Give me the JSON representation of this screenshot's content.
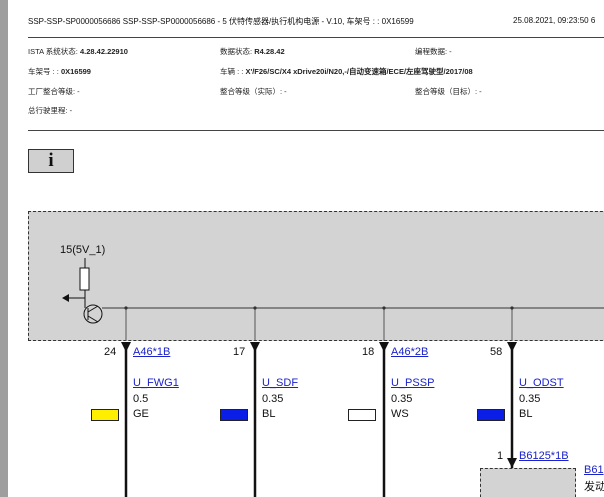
{
  "header": {
    "title": "SSP-SSP-SP0000056686 SSP-SSP-SP0000056686 - 5 伏特传感器/执行机构电源 - V.10, 车架号 : : 0X16599",
    "datetime": "25.08.2021, 09:23:50 6"
  },
  "meta": {
    "ista_label": "ISTA 系统状态:",
    "ista_value": "4.28.42.22910",
    "data_label": "数据状态:",
    "data_value": "R4.28.42",
    "prog_label": "编程数据: -",
    "vin_label": "车架号 : :",
    "vin_value": "0X16599",
    "vehicle_label": "车辆 : :",
    "vehicle_value": "X'/F26/SC/X4 xDrive20i/N20,-/自动变速箱/ECE/左座驾驶型/2017/08",
    "factory_level": "工厂整合等级: -",
    "actual_level": "整合等级（实际）: -",
    "target_level": "整合等级（目标）: -",
    "mileage": "总行驶里程: -"
  },
  "info_button": {
    "label": "i"
  },
  "diagram": {
    "supply_label": "15(5V_1)",
    "wires": [
      {
        "pin": "24",
        "connector": "A46*1B",
        "signal": "U_FWG1",
        "size": "0.5",
        "color_code": "GE",
        "color": "#ffee00"
      },
      {
        "pin": "17",
        "connector": "",
        "signal": "U_SDF",
        "size": "0.35",
        "color_code": "BL",
        "color": "#0a1ee8"
      },
      {
        "pin": "18",
        "connector": "A46*2B",
        "signal": "U_PSSP",
        "size": "0.35",
        "color_code": "WS",
        "color": "#ffffff"
      },
      {
        "pin": "58",
        "connector": "",
        "signal": "U_ODST",
        "size": "0.35",
        "color_code": "BL",
        "color": "#0a1ee8"
      }
    ],
    "lower": {
      "pin": "1",
      "connector": "B6125*1B",
      "component": "B61",
      "component_desc": "发动"
    }
  }
}
